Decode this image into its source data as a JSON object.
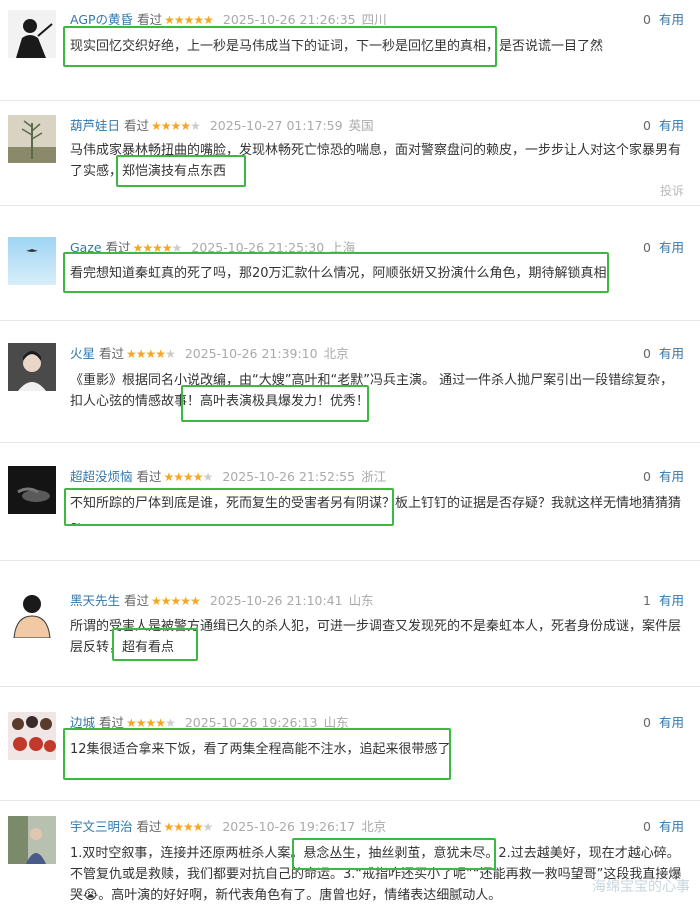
{
  "comments": [
    {
      "user": "AGPの黄昏",
      "watched": "看过",
      "stars": 5,
      "time": "2025-10-26 21:26:35",
      "location": "四川",
      "votes": "0",
      "useful": "有用",
      "text": "现实回忆交织好绝，上一秒是马伟成当下的证词，下一秒是回忆里的真相，是否说谎一目了然"
    },
    {
      "user": "葫芦娃日",
      "watched": "看过",
      "stars": 4,
      "time": "2025-10-27 01:17:59",
      "location": "英国",
      "votes": "0",
      "useful": "有用",
      "text": "马伟成家暴林畅扭曲的嘴脸，发现林畅死亡惊恐的喘息，面对警察盘问的赖皮，一步步让人对这个家暴男有了实感，郑恺演技有点东西",
      "report": "投诉"
    },
    {
      "user": "Gaze",
      "watched": "看过",
      "stars": 4,
      "time": "2025-10-26 21:25:30",
      "location": "上海",
      "votes": "0",
      "useful": "有用",
      "text": "看完想知道秦虹真的死了吗，那20万汇款什么情况，阿顺张妍又扮演什么角色，期待解锁真相"
    },
    {
      "user": "火星",
      "watched": "看过",
      "stars": 4,
      "time": "2025-10-26 21:39:10",
      "location": "北京",
      "votes": "0",
      "useful": "有用",
      "text": "《重影》根据同名小说改编，由“大嫂”高叶和“老默”冯兵主演。 通过一件杀人抛尸案引出一段错综复杂，扣人心弦的情感故事！高叶表演极具爆发力！优秀！"
    },
    {
      "user": "超超没烦恼",
      "watched": "看过",
      "stars": 4,
      "time": "2025-10-26 21:52:55",
      "location": "浙江",
      "votes": "0",
      "useful": "有用",
      "text": "不知所踪的尸体到底是谁，死而复生的受害者另有阴谋？板上钉钉的证据是否存疑？我就这样无情地猜猜猜~"
    },
    {
      "user": "黑天先生",
      "watched": "看过",
      "stars": 5,
      "time": "2025-10-26 21:10:41",
      "location": "山东",
      "votes": "1",
      "useful": "有用",
      "text": "所谓的受害人是被警方通缉已久的杀人犯，可进一步调查又发现死的不是秦虹本人，死者身份成谜，案件层层反转，超有看点"
    },
    {
      "user": "边城",
      "watched": "看过",
      "stars": 4,
      "time": "2025-10-26 19:26:13",
      "location": "山东",
      "votes": "0",
      "useful": "有用",
      "text": "12集很适合拿来下饭，看了两集全程高能不注水，追起来很带感了"
    },
    {
      "user": "宇文三明治",
      "watched": "看过",
      "stars": 4,
      "time": "2025-10-26 19:26:17",
      "location": "北京",
      "votes": "0",
      "useful": "有用",
      "text": "1.双时空叙事，连接并还原两桩杀人案。悬念丛生，抽丝剥茧，意犹未尽。2.过去越美好，现在才越心碎。不管复仇或是救赎，我们都要对抗自己的命运。3.“戒指咋还买小了呢”“还能再救一救吗望哥”这段我直接爆哭😭。高叶演的好好啊，新代表角色有了。唐曾也好，情绪表达细腻动人。"
    }
  ],
  "watermark": "海绵宝宝的心事",
  "colors": {
    "link": "#3377aa",
    "star": "#f5a623",
    "highlight_box": "#3db840"
  }
}
